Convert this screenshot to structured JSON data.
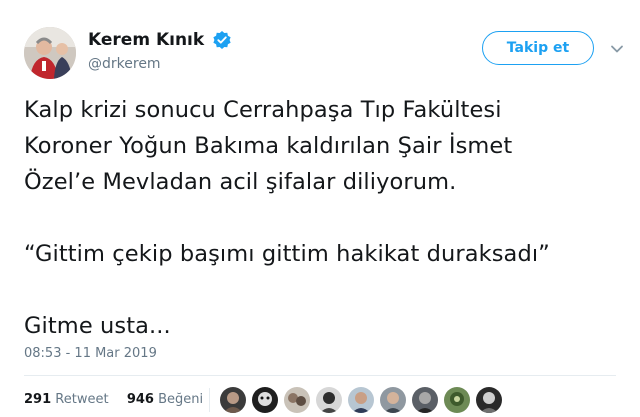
{
  "user": {
    "display_name": "Kerem Kınık",
    "handle": "@drkerem",
    "verified": true
  },
  "follow_button": {
    "label": "Takip et"
  },
  "tweet": {
    "lines_1": [
      "Kalp krizi sonucu Cerrahpaşa Tıp Fakültesi",
      "Koroner Yoğun Bakıma kaldırılan Şair İsmet",
      "Özel’e Mevladan acil şifalar diliyorum."
    ],
    "line_2": "“Gittim çekip başımı gittim hakikat duraksadı”",
    "line_3": "Gitme usta..."
  },
  "timestamp": "08:53 - 11 Mar 2019",
  "stats": {
    "retweets_count": "291",
    "retweets_label": "Retweet",
    "likes_count": "946",
    "likes_label": "Beğeni"
  },
  "colors": {
    "accent": "#1da1f2",
    "secondary_text": "#657786",
    "primary_text": "#14171a",
    "divider": "#e6ecf0"
  },
  "icons": [
    "verified-badge-icon",
    "chevron-down-icon"
  ]
}
